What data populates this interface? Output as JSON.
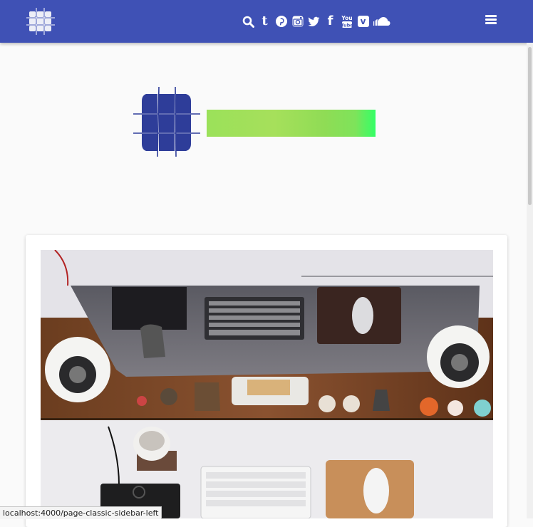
{
  "navbar": {
    "background": "#3f51b5",
    "brand_icon": "grid-logo-icon",
    "social_icons": [
      "search-icon",
      "tumblr-icon",
      "pinterest-icon",
      "instagram-icon",
      "twitter-icon",
      "facebook-icon",
      "youtube-icon",
      "vimeo-icon",
      "soundcloud-icon"
    ],
    "tumblr_glyph": "t",
    "facebook_glyph": "f",
    "youtube_glyph": "You Tube",
    "vimeo_glyph": "v",
    "menu_icon": "hamburger-menu-icon"
  },
  "header": {
    "logo_icon": "grid-logo-icon",
    "logo_color": "#2e3d99",
    "logo_text_image": "green-wordmark-image"
  },
  "content": {
    "featured_image": "desk-workspace-photo"
  },
  "status_bar": {
    "url": "localhost:4000/page-classic-sidebar-left"
  }
}
